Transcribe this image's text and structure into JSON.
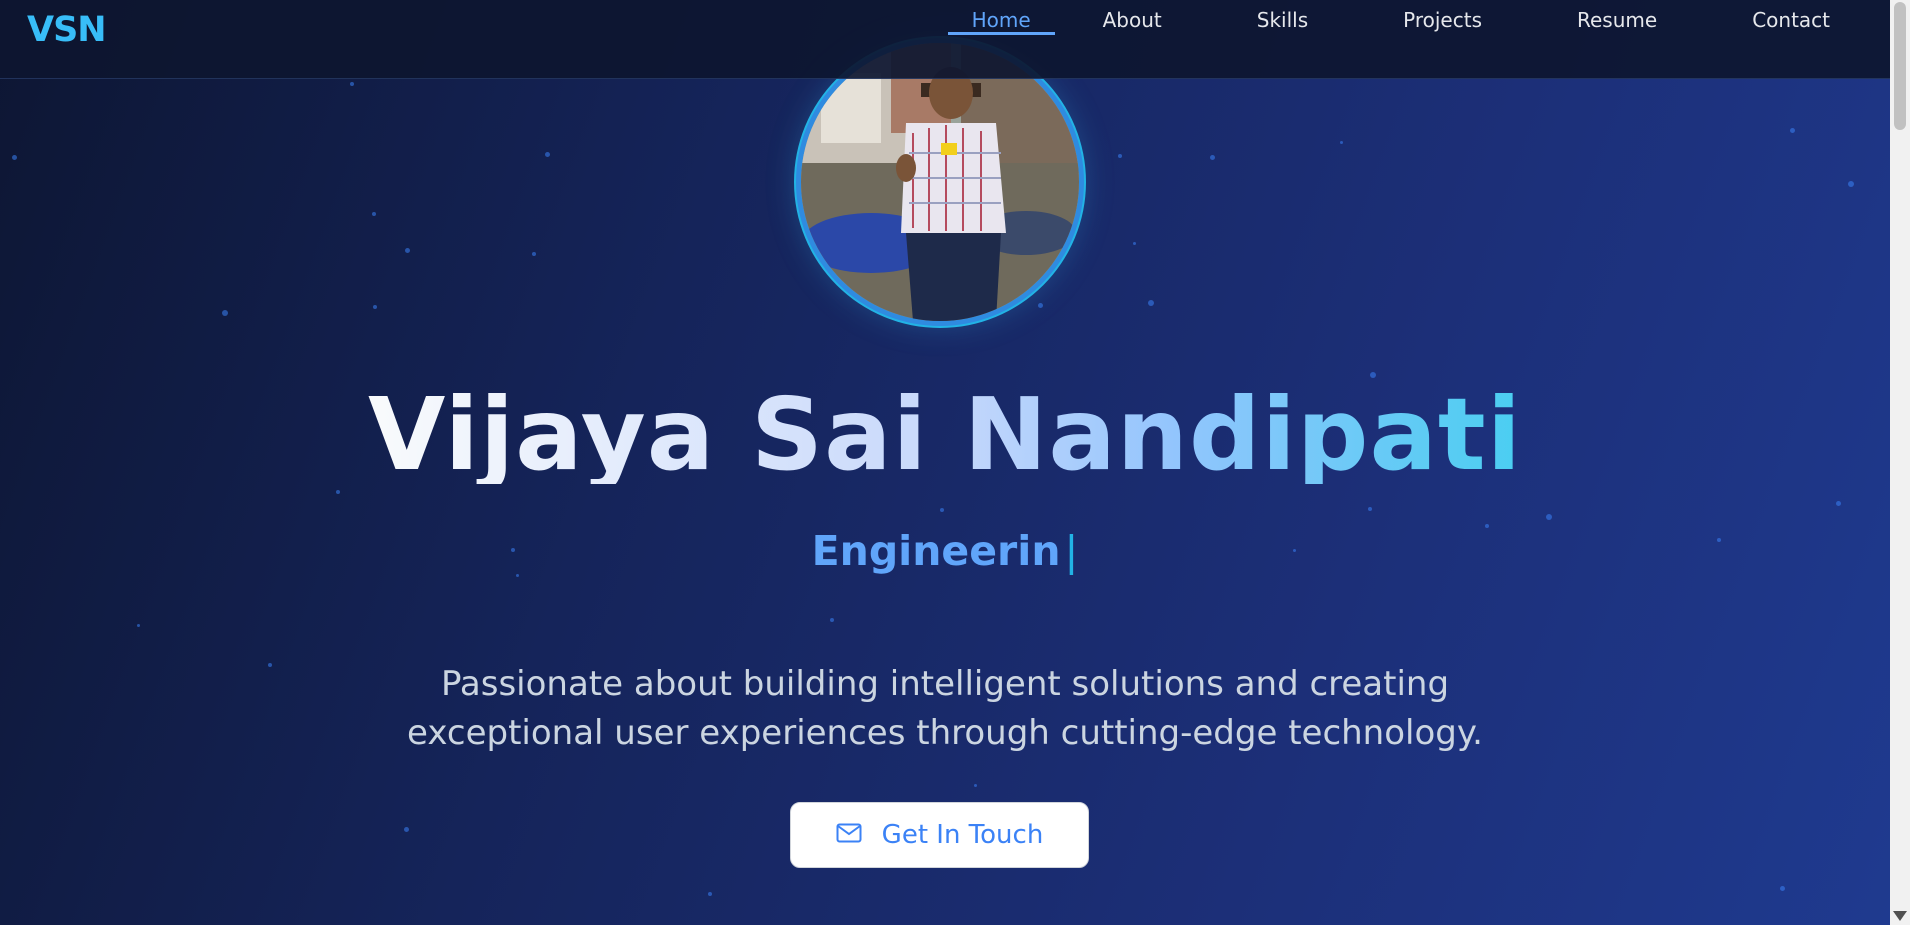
{
  "navbar": {
    "logo": "VSN",
    "links": [
      {
        "label": "Home",
        "active": true
      },
      {
        "label": "About",
        "active": false
      },
      {
        "label": "Skills",
        "active": false
      },
      {
        "label": "Projects",
        "active": false
      },
      {
        "label": "Resume",
        "active": false
      },
      {
        "label": "Contact",
        "active": false
      }
    ]
  },
  "hero": {
    "name": "Vijaya Sai Nandipati",
    "role_typed": "Engineerin",
    "cursor": "|",
    "description": "Passionate about building intelligent solutions and creating exceptional user experiences through cutting-edge technology.",
    "cta_label": "Get In Touch",
    "cta_icon": "mail-icon"
  },
  "colors": {
    "accent": "#60a5fa",
    "logo": "#38bdf8",
    "background_start": "#0d1633",
    "background_end": "#1f3a8f"
  }
}
